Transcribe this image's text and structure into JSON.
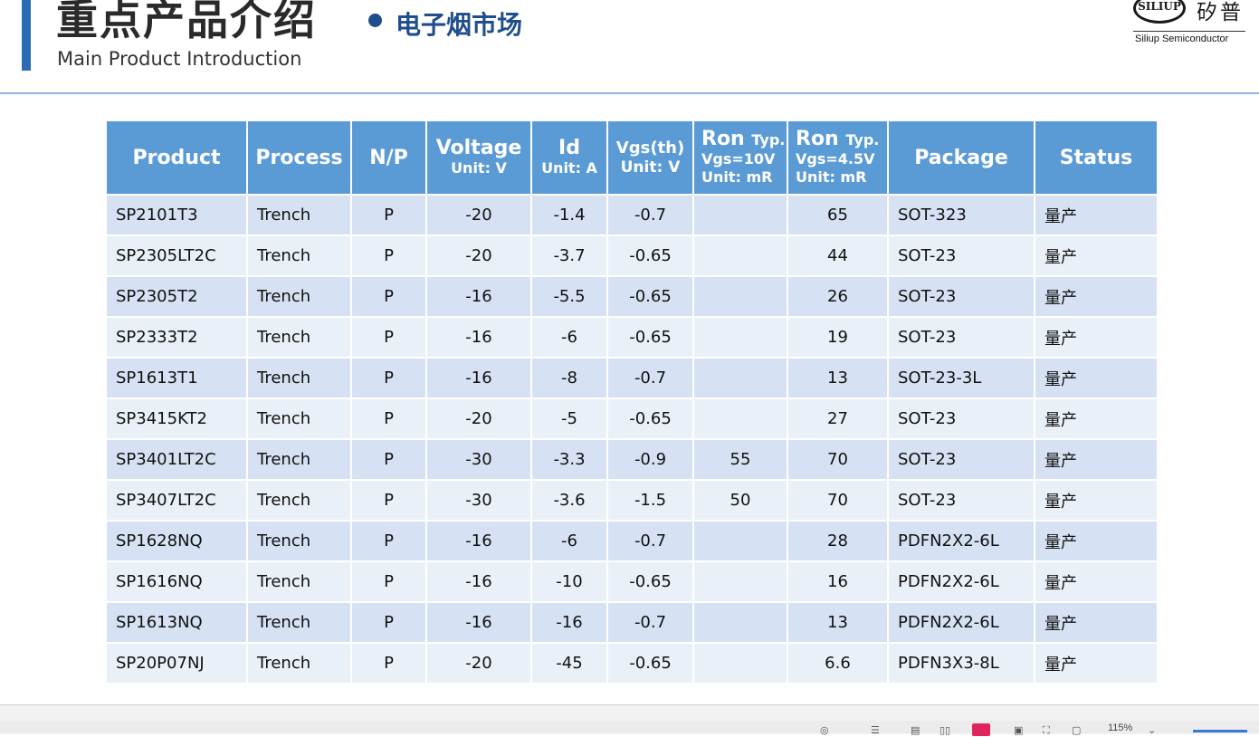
{
  "header": {
    "title_cn": "重点产品介绍",
    "title_en": "Main Product Introduction",
    "subtitle_cn": "电子烟市场",
    "accent_color": "#2b6cb3"
  },
  "logo": {
    "brand": "SILIUP",
    "brand_cn": "矽普",
    "company_en": "Siliup Semiconductor"
  },
  "table": {
    "header_color": "#5b9bd5",
    "row_color_odd": "#d6e2f3",
    "row_color_even": "#eaf0f8",
    "columns": [
      {
        "label": "Product",
        "unit": ""
      },
      {
        "label": "Process",
        "unit": ""
      },
      {
        "label": "N/P",
        "unit": ""
      },
      {
        "label": "Voltage",
        "unit": "Unit: V"
      },
      {
        "label": "Id",
        "unit": "Unit: A"
      },
      {
        "label": "Vgs(th)",
        "unit": "Unit: V"
      },
      {
        "label": "Ron",
        "label_suffix": "Typ.",
        "cond": "Vgs=10V",
        "unit": "Unit: mR"
      },
      {
        "label": "Ron",
        "label_suffix": "Typ.",
        "cond": "Vgs=4.5V",
        "unit": "Unit: mR"
      },
      {
        "label": "Package",
        "unit": ""
      },
      {
        "label": "Status",
        "unit": ""
      }
    ],
    "rows": [
      [
        "SP2101T3",
        "Trench",
        "P",
        "-20",
        "-1.4",
        "-0.7",
        "",
        "65",
        "SOT-323",
        "量产"
      ],
      [
        "SP2305LT2C",
        "Trench",
        "P",
        "-20",
        "-3.7",
        "-0.65",
        "",
        "44",
        "SOT-23",
        "量产"
      ],
      [
        "SP2305T2",
        "Trench",
        "P",
        "-16",
        "-5.5",
        "-0.65",
        "",
        "26",
        "SOT-23",
        "量产"
      ],
      [
        "SP2333T2",
        "Trench",
        "P",
        "-16",
        "-6",
        "-0.65",
        "",
        "19",
        "SOT-23",
        "量产"
      ],
      [
        "SP1613T1",
        "Trench",
        "P",
        "-16",
        "-8",
        "-0.7",
        "",
        "13",
        "SOT-23-3L",
        "量产"
      ],
      [
        "SP3415KT2",
        "Trench",
        "P",
        "-20",
        "-5",
        "-0.65",
        "",
        "27",
        "SOT-23",
        "量产"
      ],
      [
        "SP3401LT2C",
        "Trench",
        "P",
        "-30",
        "-3.3",
        "-0.9",
        "55",
        "70",
        "SOT-23",
        "量产"
      ],
      [
        "SP3407LT2C",
        "Trench",
        "P",
        "-30",
        "-3.6",
        "-1.5",
        "50",
        "70",
        "SOT-23",
        "量产"
      ],
      [
        "SP1628NQ",
        "Trench",
        "P",
        "-16",
        "-6",
        "-0.7",
        "",
        "28",
        "PDFN2X2-6L",
        "量产"
      ],
      [
        "SP1616NQ",
        "Trench",
        "P",
        "-16",
        "-10",
        "-0.65",
        "",
        "16",
        "PDFN2X2-6L",
        "量产"
      ],
      [
        "SP1613NQ",
        "Trench",
        "P",
        "-16",
        "-16",
        "-0.7",
        "",
        "13",
        "PDFN2X2-6L",
        "量产"
      ],
      [
        "SP20P07NJ",
        "Trench",
        "P",
        "-20",
        "-45",
        "-0.65",
        "",
        "6.6",
        "PDFN3X3-8L",
        "量产"
      ]
    ]
  },
  "statusbar": {
    "zoom": "115%"
  }
}
